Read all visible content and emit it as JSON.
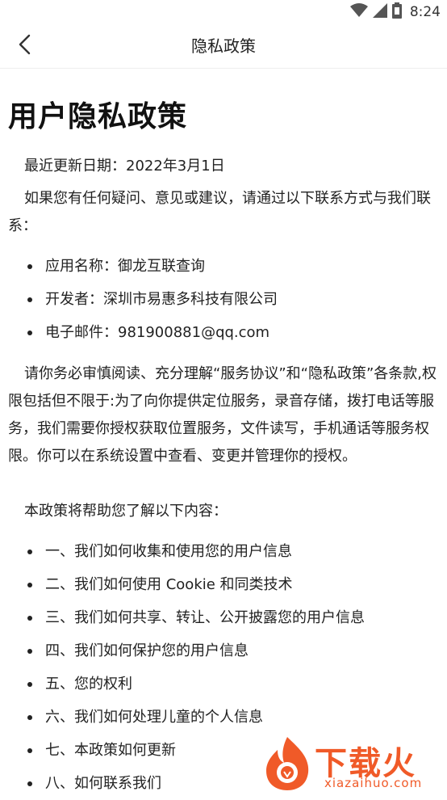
{
  "status_bar": {
    "time": "8:24"
  },
  "app_bar": {
    "title": "隐私政策"
  },
  "document": {
    "title": "用户隐私政策",
    "update_line": "最近更新日期：2022年3月1日",
    "contact_intro": "如果您有任何疑问、意见或建议，请通过以下联系方式与我们联系：",
    "contact_items": [
      "应用名称：御龙互联查询",
      "开发者：深圳市易惠多科技有限公司",
      "电子邮件：981900881@qq.com"
    ],
    "consent_paragraph": "请你务必审慎阅读、充分理解“服务协议”和“隐私政策”各条款,权限包括但不限于:为了向你提供定位服务，录音存储，拨打电话等服务，我们需要你授权获取位置服务，文件读写，手机通话等服务权限。你可以在系统设置中查看、变更并管理你的授权。",
    "summary_intro": "本政策将帮助您了解以下内容：",
    "summary_items": [
      "一、我们如何收集和使用您的用户信息",
      "二、我们如何使用 Cookie 和同类技术",
      "三、我们如何共享、转让、公开披露您的用户信息",
      "四、我们如何保护您的用户信息",
      "五、您的权利",
      "六、我们如何处理儿童的个人信息",
      "七、本政策如何更新",
      "八、如何联系我们"
    ]
  },
  "watermark": {
    "brand": "下载火",
    "url": "xiazaihuo.com"
  },
  "colors": {
    "watermark": "#f05a28",
    "text": "#222222"
  }
}
